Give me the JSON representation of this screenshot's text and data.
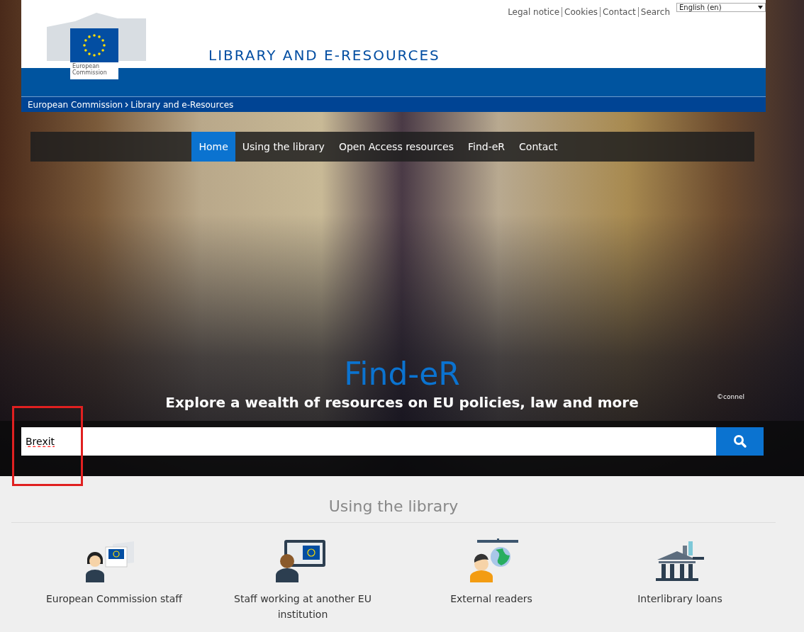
{
  "top_links": [
    "Legal notice",
    "Cookies",
    "Contact",
    "Search"
  ],
  "language": {
    "value": "English (en)"
  },
  "logo": {
    "line1": "European",
    "line2": "Commission"
  },
  "site_title": "LIBRARY AND E-RESOURCES",
  "breadcrumb": [
    {
      "label": "European Commission"
    },
    {
      "label": "Library and e-Resources"
    }
  ],
  "nav": [
    {
      "label": "Home",
      "selected": true
    },
    {
      "label": "Using the library",
      "selected": false
    },
    {
      "label": "Open Access resources",
      "selected": false
    },
    {
      "label": "Find-eR",
      "selected": false
    },
    {
      "label": "Contact",
      "selected": false
    }
  ],
  "hero": {
    "title": "Find-eR",
    "subtitle": "Explore a wealth of resources on EU policies, law and more",
    "credit": "©connel"
  },
  "search": {
    "value": "Brexit"
  },
  "section": {
    "title": "Using the library",
    "items": [
      {
        "kind": "staff",
        "label": "European Commission staff"
      },
      {
        "kind": "institution",
        "label": "Staff working at another EU institution"
      },
      {
        "kind": "external",
        "label": "External readers"
      },
      {
        "kind": "loans",
        "label": "Interlibrary loans"
      }
    ]
  }
}
